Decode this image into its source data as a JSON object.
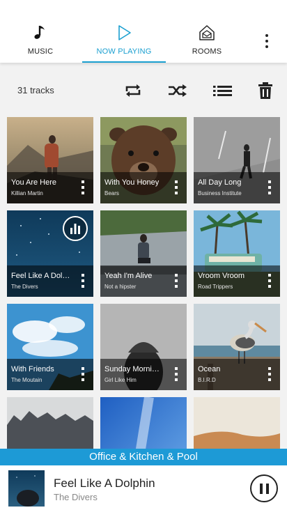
{
  "nav": {
    "tabs": [
      {
        "label": "MUSIC",
        "icon": "music-note-icon",
        "active": false
      },
      {
        "label": "NOW PLAYING",
        "icon": "play-outline-icon",
        "active": true
      },
      {
        "label": "ROOMS",
        "icon": "speaker-house-icon",
        "active": false
      }
    ],
    "overflow_icon": "more-vertical-icon"
  },
  "toolbar": {
    "track_count": "31 tracks",
    "actions": [
      "repeat-icon",
      "shuffle-icon",
      "queue-list-icon",
      "trash-icon"
    ]
  },
  "tracks": [
    {
      "title": "You Are Here",
      "artist": "Killian Martin"
    },
    {
      "title": "With You Honey",
      "artist": "Bears"
    },
    {
      "title": "All Day Long",
      "artist": "Business Institute"
    },
    {
      "title": "Feel Like A Dol…",
      "artist": "The Divers",
      "playing": true
    },
    {
      "title": "Yeah I'm Alive",
      "artist": "Not a hipster"
    },
    {
      "title": "Vroom Vroom",
      "artist": "Road Trippers"
    },
    {
      "title": "With Friends",
      "artist": "The Moutain"
    },
    {
      "title": "Sunday Morni…",
      "artist": "Girl Like Him"
    },
    {
      "title": "Ocean",
      "artist": "B.I.R.D"
    }
  ],
  "room_bar": {
    "label": "Office & Kitchen & Pool"
  },
  "now_playing": {
    "title": "Feel Like A Dolphin",
    "artist": "The Divers",
    "control": "pause-icon"
  },
  "colors": {
    "accent": "#1a9fd0",
    "room_bar": "#1d9ad6",
    "background": "#f2f2f2"
  }
}
